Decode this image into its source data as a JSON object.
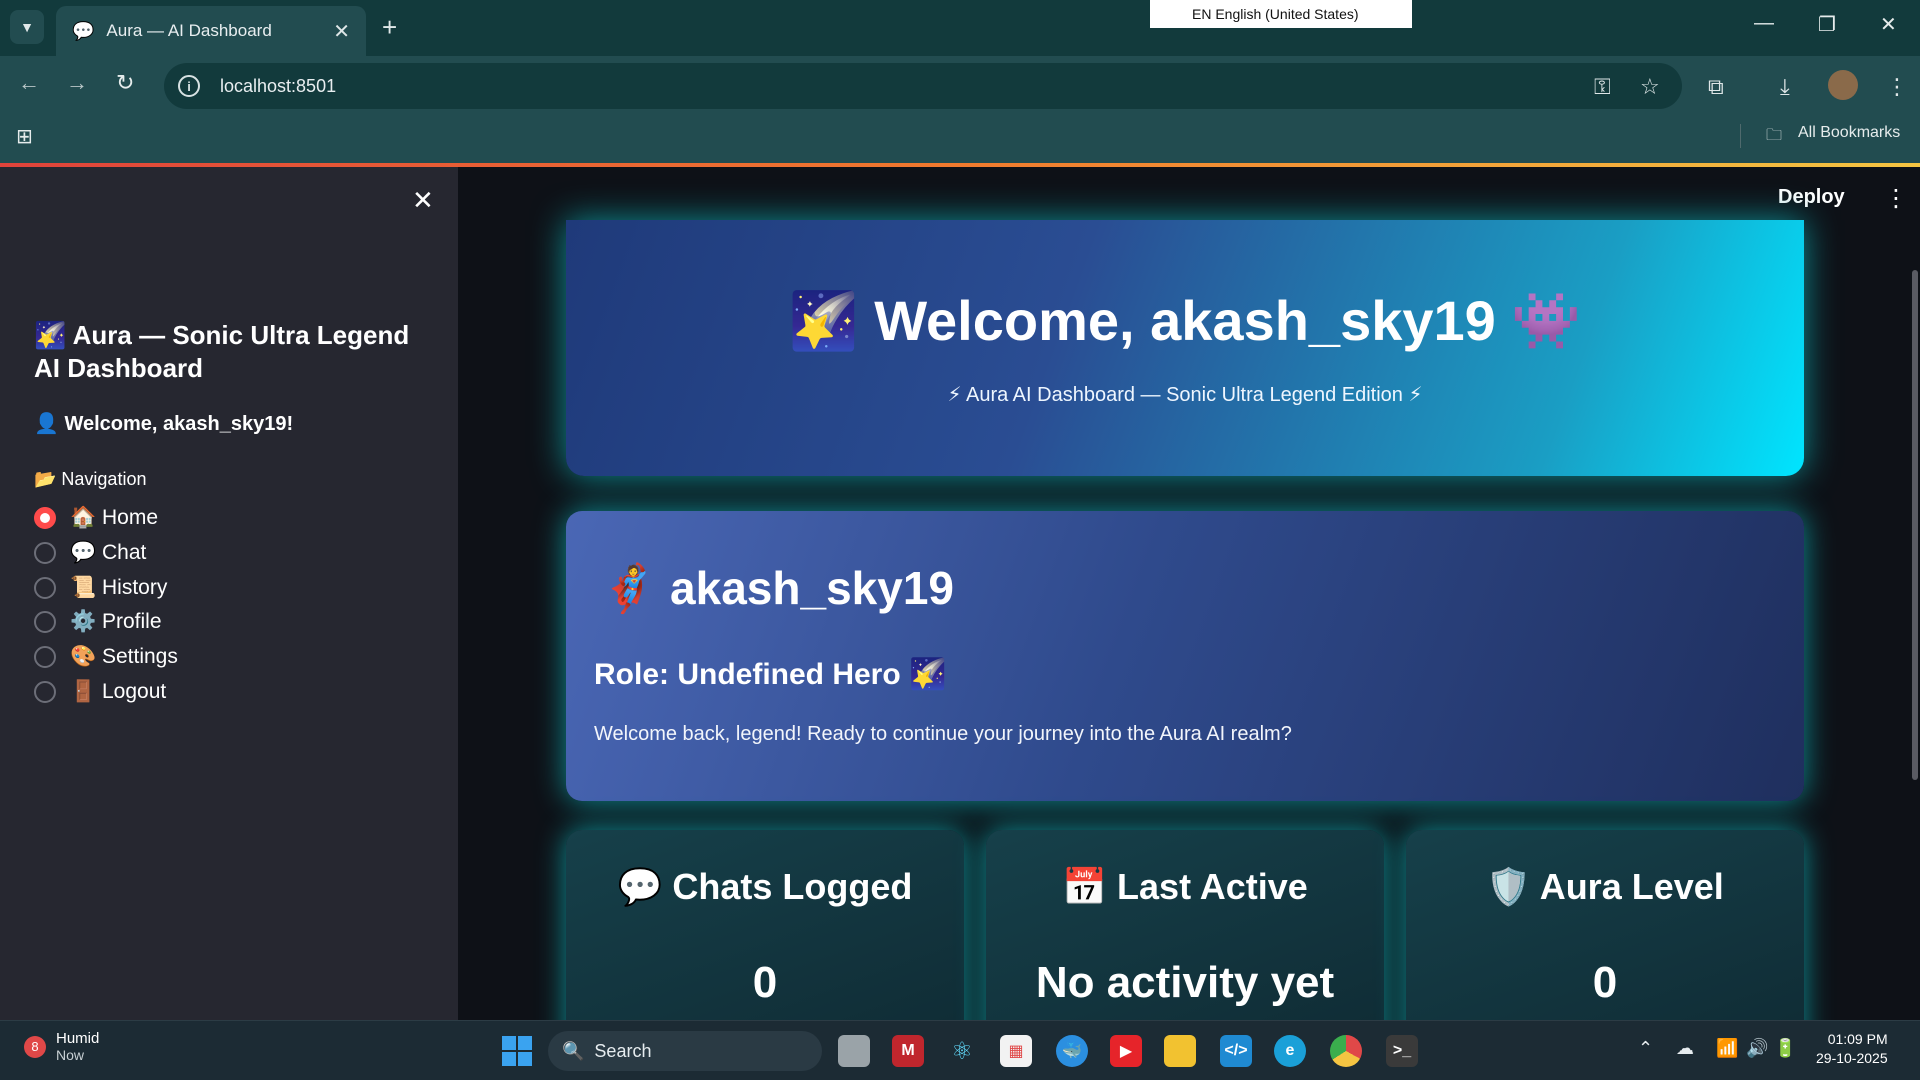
{
  "browser": {
    "tab_title": "Aura — AI Dashboard",
    "url": "localhost:8501",
    "language_indicator": "EN English (United States)",
    "bookmarks_label": "All Bookmarks"
  },
  "sidebar": {
    "title": "🌠 Aura — Sonic Ultra Legend AI Dashboard",
    "welcome": "👤 Welcome, akash_sky19!",
    "nav_label": "📂 Navigation",
    "items": [
      {
        "label": "🏠 Home",
        "selected": true
      },
      {
        "label": "💬 Chat",
        "selected": false
      },
      {
        "label": "📜 History",
        "selected": false
      },
      {
        "label": "⚙️ Profile",
        "selected": false
      },
      {
        "label": "🎨 Settings",
        "selected": false
      },
      {
        "label": "🚪 Logout",
        "selected": false
      }
    ]
  },
  "header": {
    "deploy_label": "Deploy"
  },
  "hero": {
    "title": "🌠 Welcome, akash_sky19 👾",
    "subtitle": "⚡ Aura AI Dashboard — Sonic Ultra Legend Edition ⚡"
  },
  "profile_card": {
    "name": "🦸 akash_sky19",
    "role": "Role: Undefined Hero 🌠",
    "message": "Welcome back, legend! Ready to continue your journey into the Aura AI realm?"
  },
  "stats": [
    {
      "label": "💬 Chats Logged",
      "value": "0"
    },
    {
      "label": "📅 Last Active",
      "value": "No activity yet"
    },
    {
      "label": "🛡️ Aura Level",
      "value": "0"
    }
  ],
  "taskbar": {
    "weather_badge": "8",
    "weather_title": "Humid",
    "weather_sub": "Now",
    "search_placeholder": "Search",
    "time": "01:09 PM",
    "date": "29-10-2025"
  },
  "colors": {
    "accent": "#ff4b4b",
    "glow": "#0e8f95",
    "hero_end": "#00e5ff"
  }
}
